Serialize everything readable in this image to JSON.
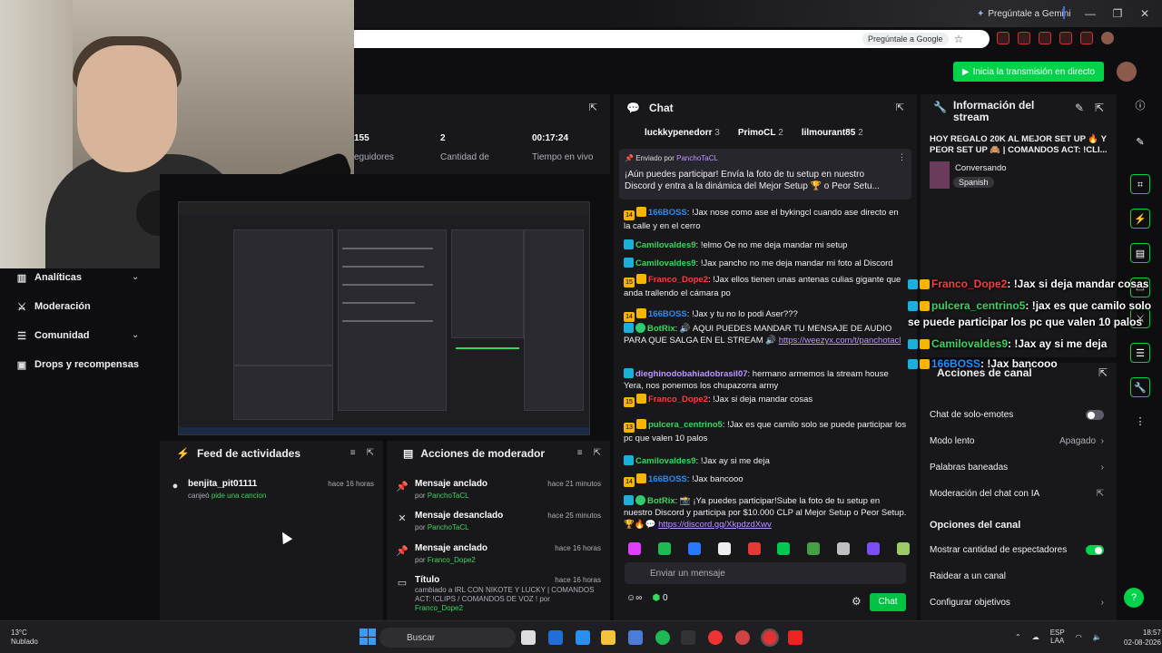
{
  "browser": {
    "gemini": "Pregúntale a Gemini",
    "google_pill": "Pregúntale a Google"
  },
  "header": {
    "go_live": "Inicia la transmisión en directo"
  },
  "nav": {
    "items": [
      {
        "label": "Analíticas"
      },
      {
        "label": "Moderación"
      },
      {
        "label": "Comunidad"
      },
      {
        "label": "Drops y recompensas"
      }
    ]
  },
  "stats": {
    "s1": {
      "value": "155",
      "label": "eguidores"
    },
    "s2": {
      "value": "2",
      "label": "Cantidad de"
    },
    "s3": {
      "value": "00:17:24",
      "label": "Tiempo en vivo"
    }
  },
  "feed": {
    "title": "Feed de actividades",
    "item": {
      "user": "benjita_pit01111",
      "action": "canjeó",
      "reward": "pide una cancion",
      "time": "hace 16 horas"
    }
  },
  "modact": {
    "title": "Acciones de moderador",
    "items": [
      {
        "title": "Mensaje anclado",
        "by": "por",
        "user": "PanchoTaCL",
        "time": "hace 21 minutos"
      },
      {
        "title": "Mensaje desanclado",
        "by": "por",
        "user": "PanchoTaCL",
        "time": "hace 25 minutos"
      },
      {
        "title": "Mensaje anclado",
        "by": "por",
        "user": "Franco_Dope2",
        "time": "hace 16 horas"
      },
      {
        "title": "Título",
        "text": "cambiado a IRL CON NIKOTE Y LUCKY | COMANDOS ACT: !CLIPS / COMANDOS DE VOZ ! por",
        "user": "Franco_Dope2",
        "time": "hace 16 horas"
      }
    ]
  },
  "chat": {
    "title": "Chat",
    "top": [
      {
        "name": "luckkypenedorr",
        "n": "3"
      },
      {
        "name": "PrimoCL",
        "n": "2"
      },
      {
        "name": "lilmourant85",
        "n": "2"
      }
    ],
    "pinned": {
      "by": "Enviado por",
      "user": "PanchoTaCL",
      "text": "¡Aún puedes participar! Envía la foto de tu setup en nuestro Discord y entra a la dinámica del Mejor Setup 🏆 o Peor Setu..."
    },
    "messages": [
      {
        "badge": "14",
        "user": "166BOSS",
        "color": "#1e90ff",
        "text": "!Jax nose como ase el bykingcl cuando ase directo en la calle y en el cerro"
      },
      {
        "user": "Camilovaldes9",
        "color": "#37d65d",
        "text": "!elmo Oe no me deja mandar mi setup"
      },
      {
        "user": "Camilovaldes9",
        "color": "#37d65d",
        "text": "!Jax pancho no me deja mandar mi foto al Discord"
      },
      {
        "badge": "15",
        "user": "Franco_Dope2",
        "color": "#ff3b3b",
        "text": "!Jax ellos tienen unas antenas culias gigante que anda trallendo el cámara po"
      },
      {
        "badge": "14",
        "user": "166BOSS",
        "color": "#1e90ff",
        "text": "!Jax y tu no lo podi Aser???"
      },
      {
        "user": "BotRix",
        "color": "#37d65d",
        "text": "🔊 AQUI PUEDES MANDAR TU MENSAJE DE AUDIO PARA QUE SALGA EN EL STREAM 🔊",
        "link": "https://weezyx.com/t/panchotacl"
      },
      {
        "user": "dieghinodobahiadobrasil07",
        "color": "#bf94ff",
        "text": "hermano armemos la stream house Yera, nos ponemos los chupazorra army"
      },
      {
        "badge": "15",
        "user": "Franco_Dope2",
        "color": "#ff3b3b",
        "text": "!Jax si deja mandar cosas"
      },
      {
        "badge": "13",
        "user": "pulcera_centrino5",
        "color": "#37d65d",
        "text": "!Jax es que camilo solo se puede participar los pc que valen 10 palos"
      },
      {
        "user": "Camilovaldes9",
        "color": "#37d65d",
        "text": "!Jax ay si me deja"
      },
      {
        "badge": "14",
        "user": "166BOSS",
        "color": "#1e90ff",
        "text": "!Jax bancooo"
      },
      {
        "user": "BotRix",
        "color": "#37d65d",
        "text": "📸 ¡Ya puedes participar!Sube la foto de tu setup en nuestro Discord y participa por $10.000 CLP al Mejor Setup o Peor Setup. 🏆🔥💬",
        "link": "https://discord.gg/XkpdzdXwv"
      }
    ],
    "input_placeholder": "Enviar un mensaje",
    "points": "0",
    "send": "Chat"
  },
  "info": {
    "title": "Información del stream",
    "stream_title": "HOY REGALO 20K AL MEJOR SET UP 🔥 Y PEOR SET UP 🙈 | COMANDOS ACT: !CLI...",
    "category": "Conversando",
    "language": "Spanish"
  },
  "actions": {
    "title": "Acciones de canal",
    "opts": [
      {
        "label": "Chat de solo-emotes"
      },
      {
        "label": "Modo lento",
        "value": "Apagado"
      },
      {
        "label": "Palabras baneadas"
      },
      {
        "label": "Moderación del chat con IA"
      }
    ],
    "section": "Opciones del canal",
    "opts2": [
      {
        "label": "Mostrar cantidad de espectadores"
      },
      {
        "label": "Raidear a un canal"
      },
      {
        "label": "Configurar objetivos"
      }
    ]
  },
  "overlay": [
    {
      "user": "Franco_Dope2",
      "color": "#ff3b3b",
      "text": ": !Jax si deja mandar cosas"
    },
    {
      "user": "pulcera_centrino5",
      "color": "#37d65d",
      "text": ": !jax es que camilo solo"
    },
    {
      "cont": "se puede participar los pc que valen 10 palos"
    },
    {
      "user": "Camilovaldes9",
      "color": "#37d65d",
      "text": ": !Jax ay si me deja"
    },
    {
      "user": "166BOSS",
      "color": "#1e90ff",
      "text": ": !Jax bancooo"
    }
  ],
  "taskbar": {
    "temp": "13°C",
    "weather": "Nublado",
    "search": "Buscar",
    "lang1": "ESP",
    "lang2": "LAA",
    "time": "18:57",
    "date": "02-08-2026"
  }
}
